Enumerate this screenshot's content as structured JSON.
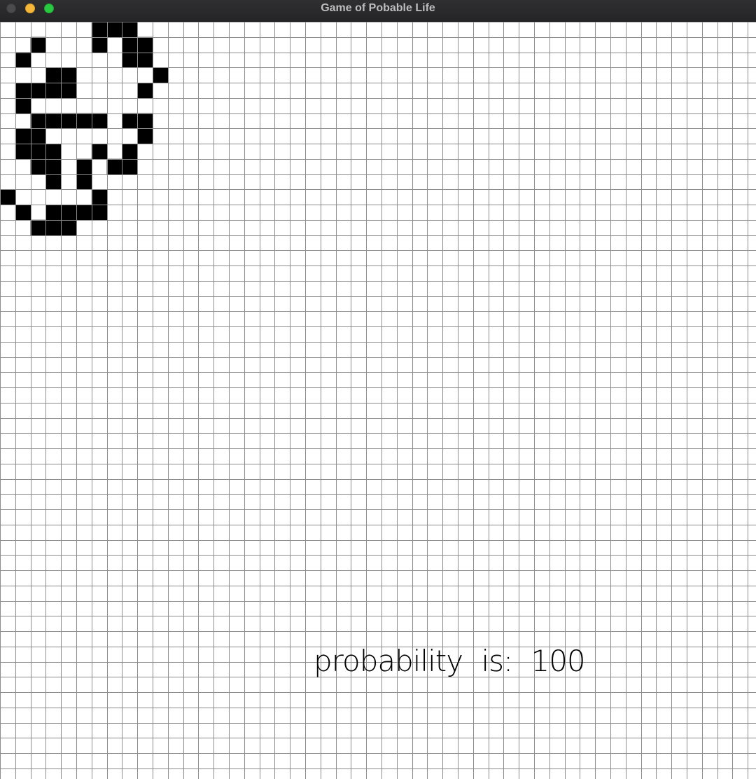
{
  "window": {
    "title": "Game of Pobable Life",
    "buttons": {
      "close_color": "#4b4b4d",
      "minimize_color": "#f6b63a",
      "maximize_color": "#28c840"
    }
  },
  "board": {
    "grid_line_color": "#8c8c8c",
    "alive_color": "#000000",
    "dead_color": "#ffffff",
    "live_cells": [
      [
        6,
        0
      ],
      [
        7,
        0
      ],
      [
        8,
        0
      ],
      [
        2,
        1
      ],
      [
        6,
        1
      ],
      [
        8,
        1
      ],
      [
        9,
        1
      ],
      [
        1,
        2
      ],
      [
        8,
        2
      ],
      [
        9,
        2
      ],
      [
        3,
        3
      ],
      [
        4,
        3
      ],
      [
        10,
        3
      ],
      [
        1,
        4
      ],
      [
        2,
        4
      ],
      [
        3,
        4
      ],
      [
        4,
        4
      ],
      [
        9,
        4
      ],
      [
        1,
        5
      ],
      [
        2,
        6
      ],
      [
        3,
        6
      ],
      [
        4,
        6
      ],
      [
        5,
        6
      ],
      [
        6,
        6
      ],
      [
        8,
        6
      ],
      [
        9,
        6
      ],
      [
        1,
        7
      ],
      [
        2,
        7
      ],
      [
        9,
        7
      ],
      [
        1,
        8
      ],
      [
        2,
        8
      ],
      [
        3,
        8
      ],
      [
        6,
        8
      ],
      [
        8,
        8
      ],
      [
        2,
        9
      ],
      [
        3,
        9
      ],
      [
        5,
        9
      ],
      [
        7,
        9
      ],
      [
        8,
        9
      ],
      [
        3,
        10
      ],
      [
        5,
        10
      ],
      [
        0,
        11
      ],
      [
        6,
        11
      ],
      [
        1,
        12
      ],
      [
        3,
        12
      ],
      [
        4,
        12
      ],
      [
        5,
        12
      ],
      [
        6,
        12
      ],
      [
        2,
        13
      ],
      [
        3,
        13
      ],
      [
        4,
        13
      ]
    ]
  },
  "status": {
    "probability_text": "probability is: 100"
  }
}
